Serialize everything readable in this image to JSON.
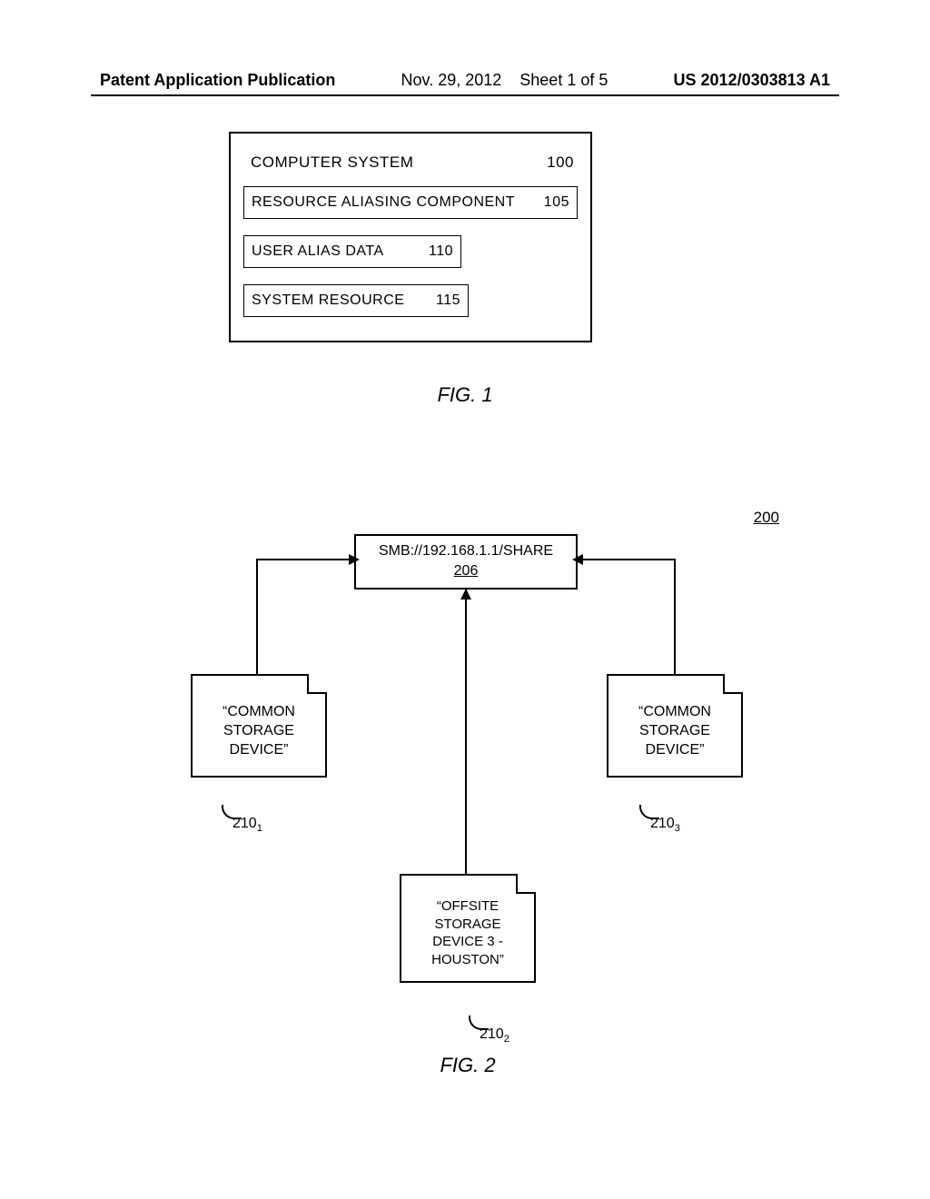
{
  "header": {
    "left": "Patent Application Publication",
    "center_date": "Nov. 29, 2012",
    "center_sheet": "Sheet 1 of 5",
    "right": "US 2012/0303813 A1"
  },
  "fig1": {
    "title": "COMPUTER SYSTEM",
    "title_num": "100",
    "box_a_label": "RESOURCE ALIASING COMPONENT",
    "box_a_num": "105",
    "box_b_label": "USER ALIAS DATA",
    "box_b_num": "110",
    "box_c_label": "SYSTEM RESOURCE",
    "box_c_num": "115",
    "caption": "FIG. 1"
  },
  "fig2": {
    "ref_overall": "200",
    "top_label": "SMB://192.168.1.1/SHARE",
    "top_num": "206",
    "note_left": "“COMMON STORAGE DEVICE”",
    "note_right": "“COMMON STORAGE DEVICE”",
    "note_center": "“OFFSITE STORAGE DEVICE 3 - HOUSTON”",
    "ref210": "210",
    "sub1": "1",
    "sub2": "2",
    "sub3": "3",
    "caption": "FIG. 2"
  }
}
